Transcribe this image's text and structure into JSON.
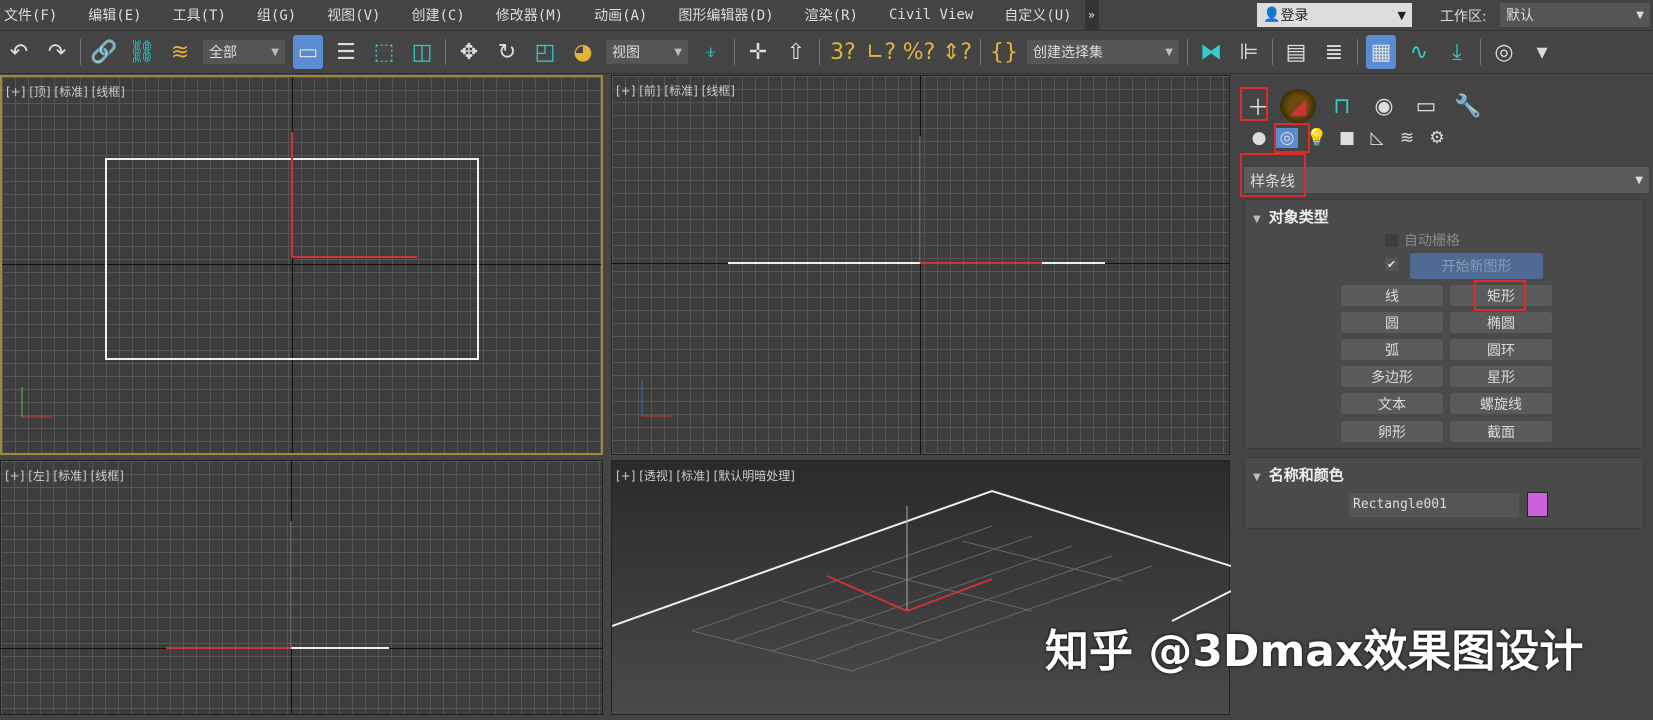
{
  "menu": [
    "文件(F)",
    "编辑(E)",
    "工具(T)",
    "组(G)",
    "视图(V)",
    "创建(C)",
    "修改器(M)",
    "动画(A)",
    "图形编辑器(D)",
    "渲染(R)",
    "Civil View",
    "自定义(U)"
  ],
  "login": {
    "label": "登录"
  },
  "workspace": {
    "label": "工作区:",
    "value": "默认"
  },
  "toolbar": {
    "selection_filter": "全部",
    "ref_coord": "视图",
    "selection_set": "创建选择集"
  },
  "viewports": {
    "top": "[+] [顶] [标准] [线框]",
    "front": "[+] [前] [标准] [线框]",
    "left": "[+] [左] [标准] [线框]",
    "perspective": "[+] [透视] [标准] [默认明暗处理]"
  },
  "panel": {
    "category": "样条线",
    "object_type": {
      "title": "对象类型",
      "autogrid": "自动栅格",
      "start_new_shape": "开始新图形",
      "buttons": [
        "线",
        "矩形",
        "圆",
        "椭圆",
        "弧",
        "圆环",
        "多边形",
        "星形",
        "文本",
        "螺旋线",
        "卵形",
        "截面"
      ]
    },
    "name_color": {
      "title": "名称和颜色",
      "name": "Rectangle001",
      "color": "#c864d8"
    }
  },
  "watermark": "知乎 @3Dmax效果图设计"
}
